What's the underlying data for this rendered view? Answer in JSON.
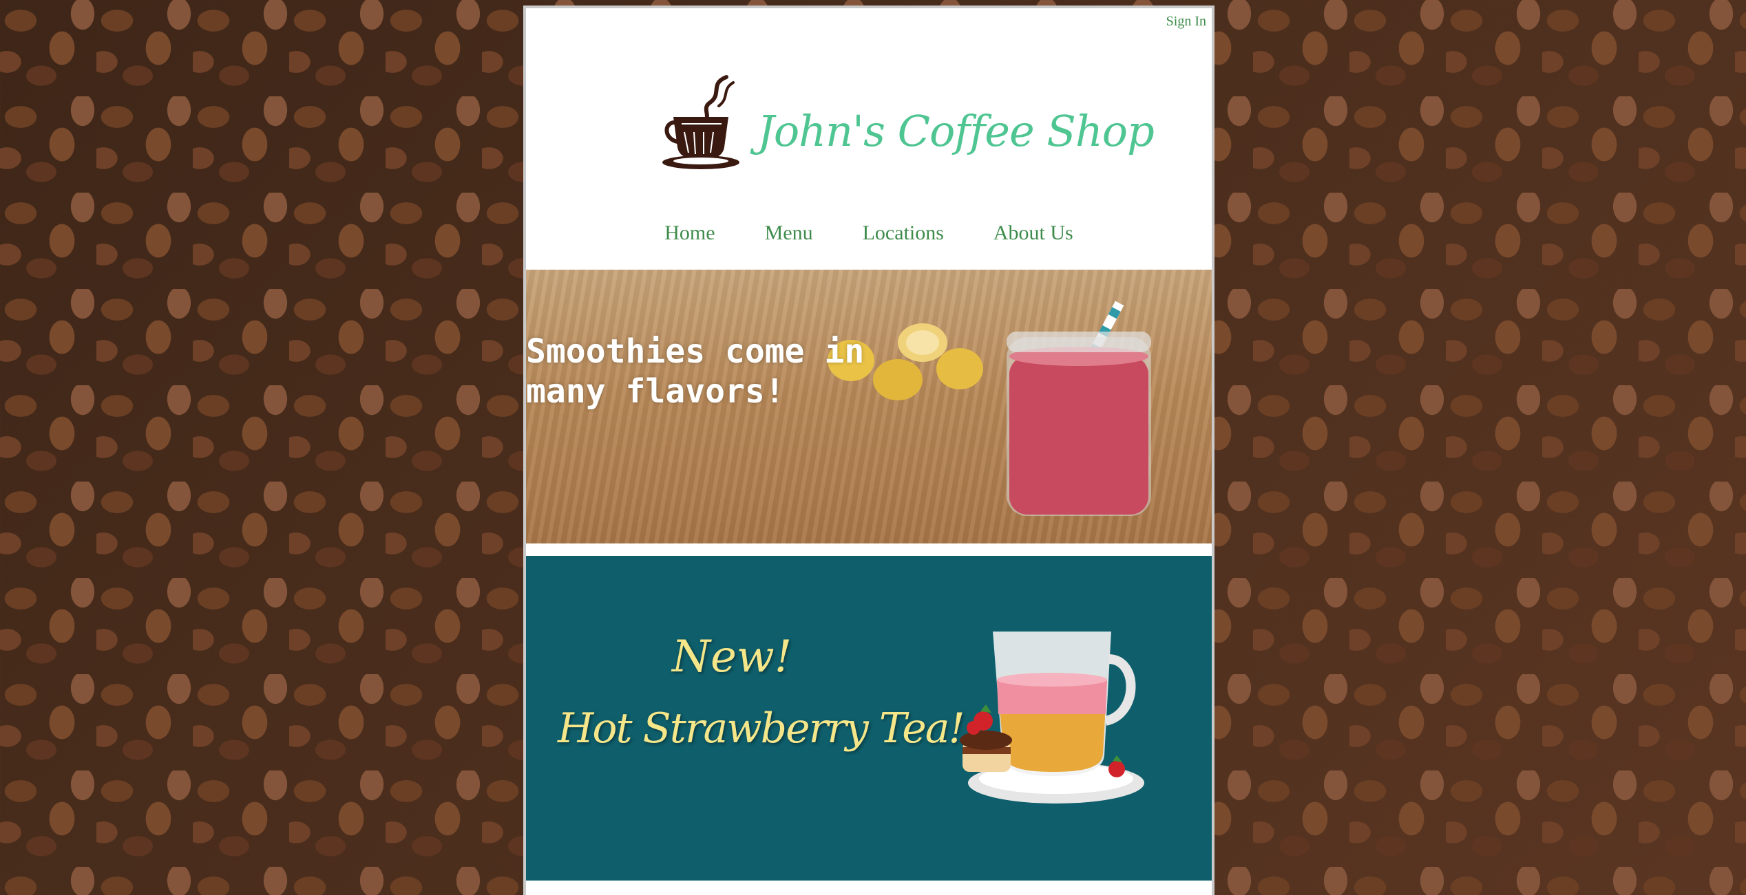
{
  "header": {
    "signin_label": "Sign In",
    "logo_text": "John's Coffee Shop"
  },
  "nav": {
    "items": [
      {
        "label": "Home"
      },
      {
        "label": "Menu"
      },
      {
        "label": "Locations"
      },
      {
        "label": "About Us"
      }
    ]
  },
  "hero": {
    "text": "Smoothies come in\nmany flavors!"
  },
  "promo": {
    "new_label": "New!",
    "title": "Hot Strawberry Tea!"
  },
  "colors": {
    "accent_green": "#3d8b4a",
    "logo_green": "#4fc592",
    "promo_bg": "#0e5e6b",
    "promo_text": "#f5e68a"
  },
  "icons": [
    "coffee-cup-logo-icon",
    "strawberry-tea-cup-icon"
  ]
}
